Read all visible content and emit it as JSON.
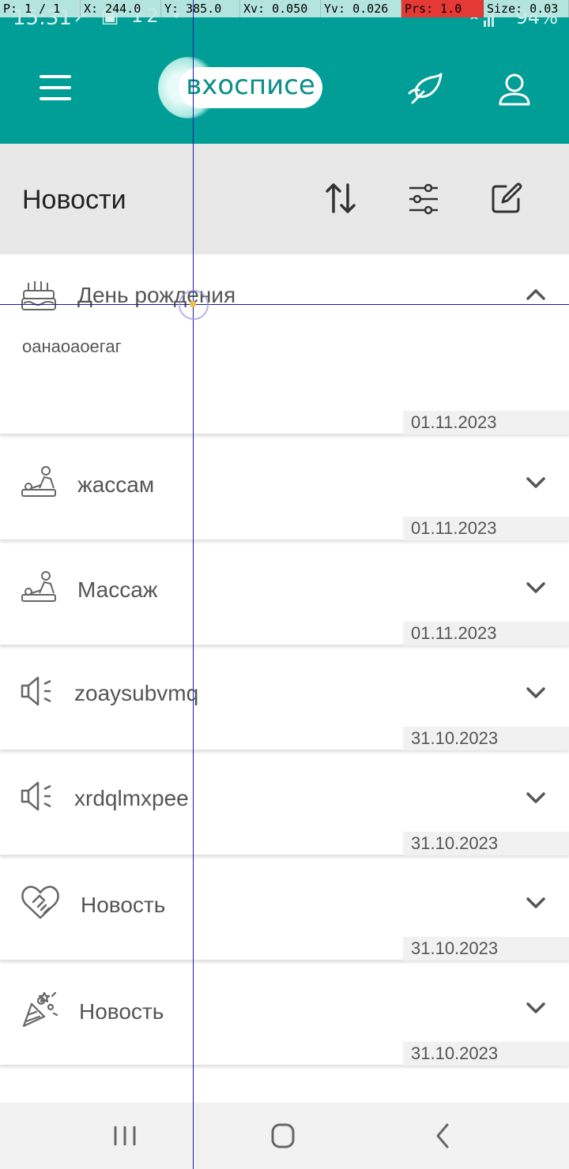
{
  "statusbar": {
    "time": "15:31",
    "icons_left": "↗ ▣ 12 •",
    "battery": "94%"
  },
  "debug": {
    "pointer": "P: 1 / 1",
    "x": "X: 244.0",
    "y": "Y: 385.0",
    "xv": "Xv: 0.050",
    "yv": "Yv: 0.026",
    "prs": "Prs: 1.0",
    "size": "Size: 0.03"
  },
  "header": {
    "logo_text": "вхосписе",
    "accent_color": "#009e96"
  },
  "section": {
    "title": "Новости"
  },
  "news": [
    {
      "icon": "birthday-cake-icon",
      "title": "День рождения",
      "body": "оанаоаоегаг",
      "date": "01.11.2023",
      "expanded": true
    },
    {
      "icon": "massage-icon",
      "title": "жассам",
      "date": "01.11.2023",
      "expanded": false
    },
    {
      "icon": "massage-icon",
      "title": "Массаж",
      "date": "01.11.2023",
      "expanded": false
    },
    {
      "icon": "megaphone-icon",
      "title": "zoaysubvmq",
      "date": "31.10.2023",
      "expanded": false
    },
    {
      "icon": "megaphone-icon",
      "title": "xrdqlmxpee",
      "date": "31.10.2023",
      "expanded": false
    },
    {
      "icon": "heart-handshake-icon",
      "title": "Новость",
      "date": "31.10.2023",
      "expanded": false
    },
    {
      "icon": "party-popper-icon",
      "title": "Новость",
      "date": "31.10.2023",
      "expanded": false
    }
  ]
}
